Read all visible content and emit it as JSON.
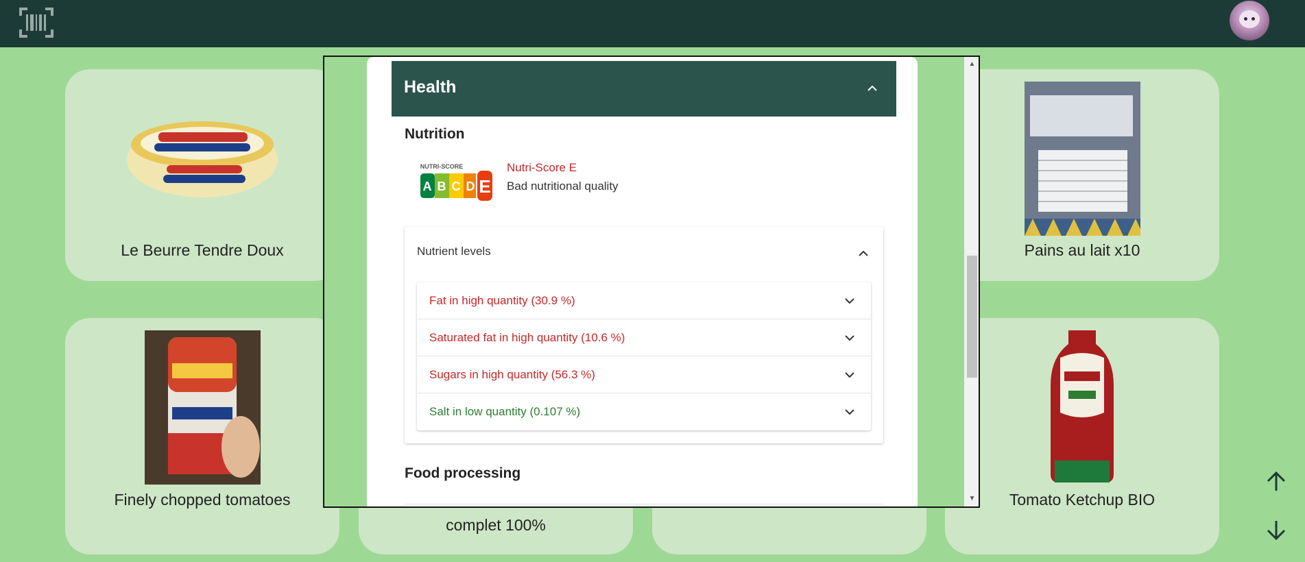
{
  "topbar": {
    "barcode_icon": "barcode-scanner-icon",
    "avatar_icon": "avatar-icon"
  },
  "products": [
    {
      "name": "Le Beurre Tendre Doux"
    },
    {
      "name": "Pains au lait x10"
    },
    {
      "name": "Finely chopped tomatoes"
    },
    {
      "name": "complet 100%"
    },
    {
      "name": "Tomato Ketchup BIO"
    }
  ],
  "modal": {
    "health": {
      "title": "Health"
    },
    "nutrition": {
      "title": "Nutrition",
      "nutriscore": {
        "title": "Nutri-Score E",
        "subtitle": "Bad nutritional quality",
        "grade": "E",
        "logo_caption": "NUTRI-SCORE",
        "letters": [
          "A",
          "B",
          "C",
          "D",
          "E"
        ]
      }
    },
    "nutrient_levels": {
      "title": "Nutrient levels",
      "items": [
        {
          "label": "Fat in high quantity (30.9 %)",
          "level": "high"
        },
        {
          "label": "Saturated fat in high quantity (10.6 %)",
          "level": "high"
        },
        {
          "label": "Sugars in high quantity (56.3 %)",
          "level": "high"
        },
        {
          "label": "Salt in low quantity (0.107 %)",
          "level": "low"
        }
      ]
    },
    "food_processing": {
      "title": "Food processing"
    }
  },
  "colors": {
    "topbar": "#1d3b36",
    "background": "#9ed895",
    "health_header": "#2b544d",
    "high": "#c62828",
    "low": "#2e7d32"
  }
}
